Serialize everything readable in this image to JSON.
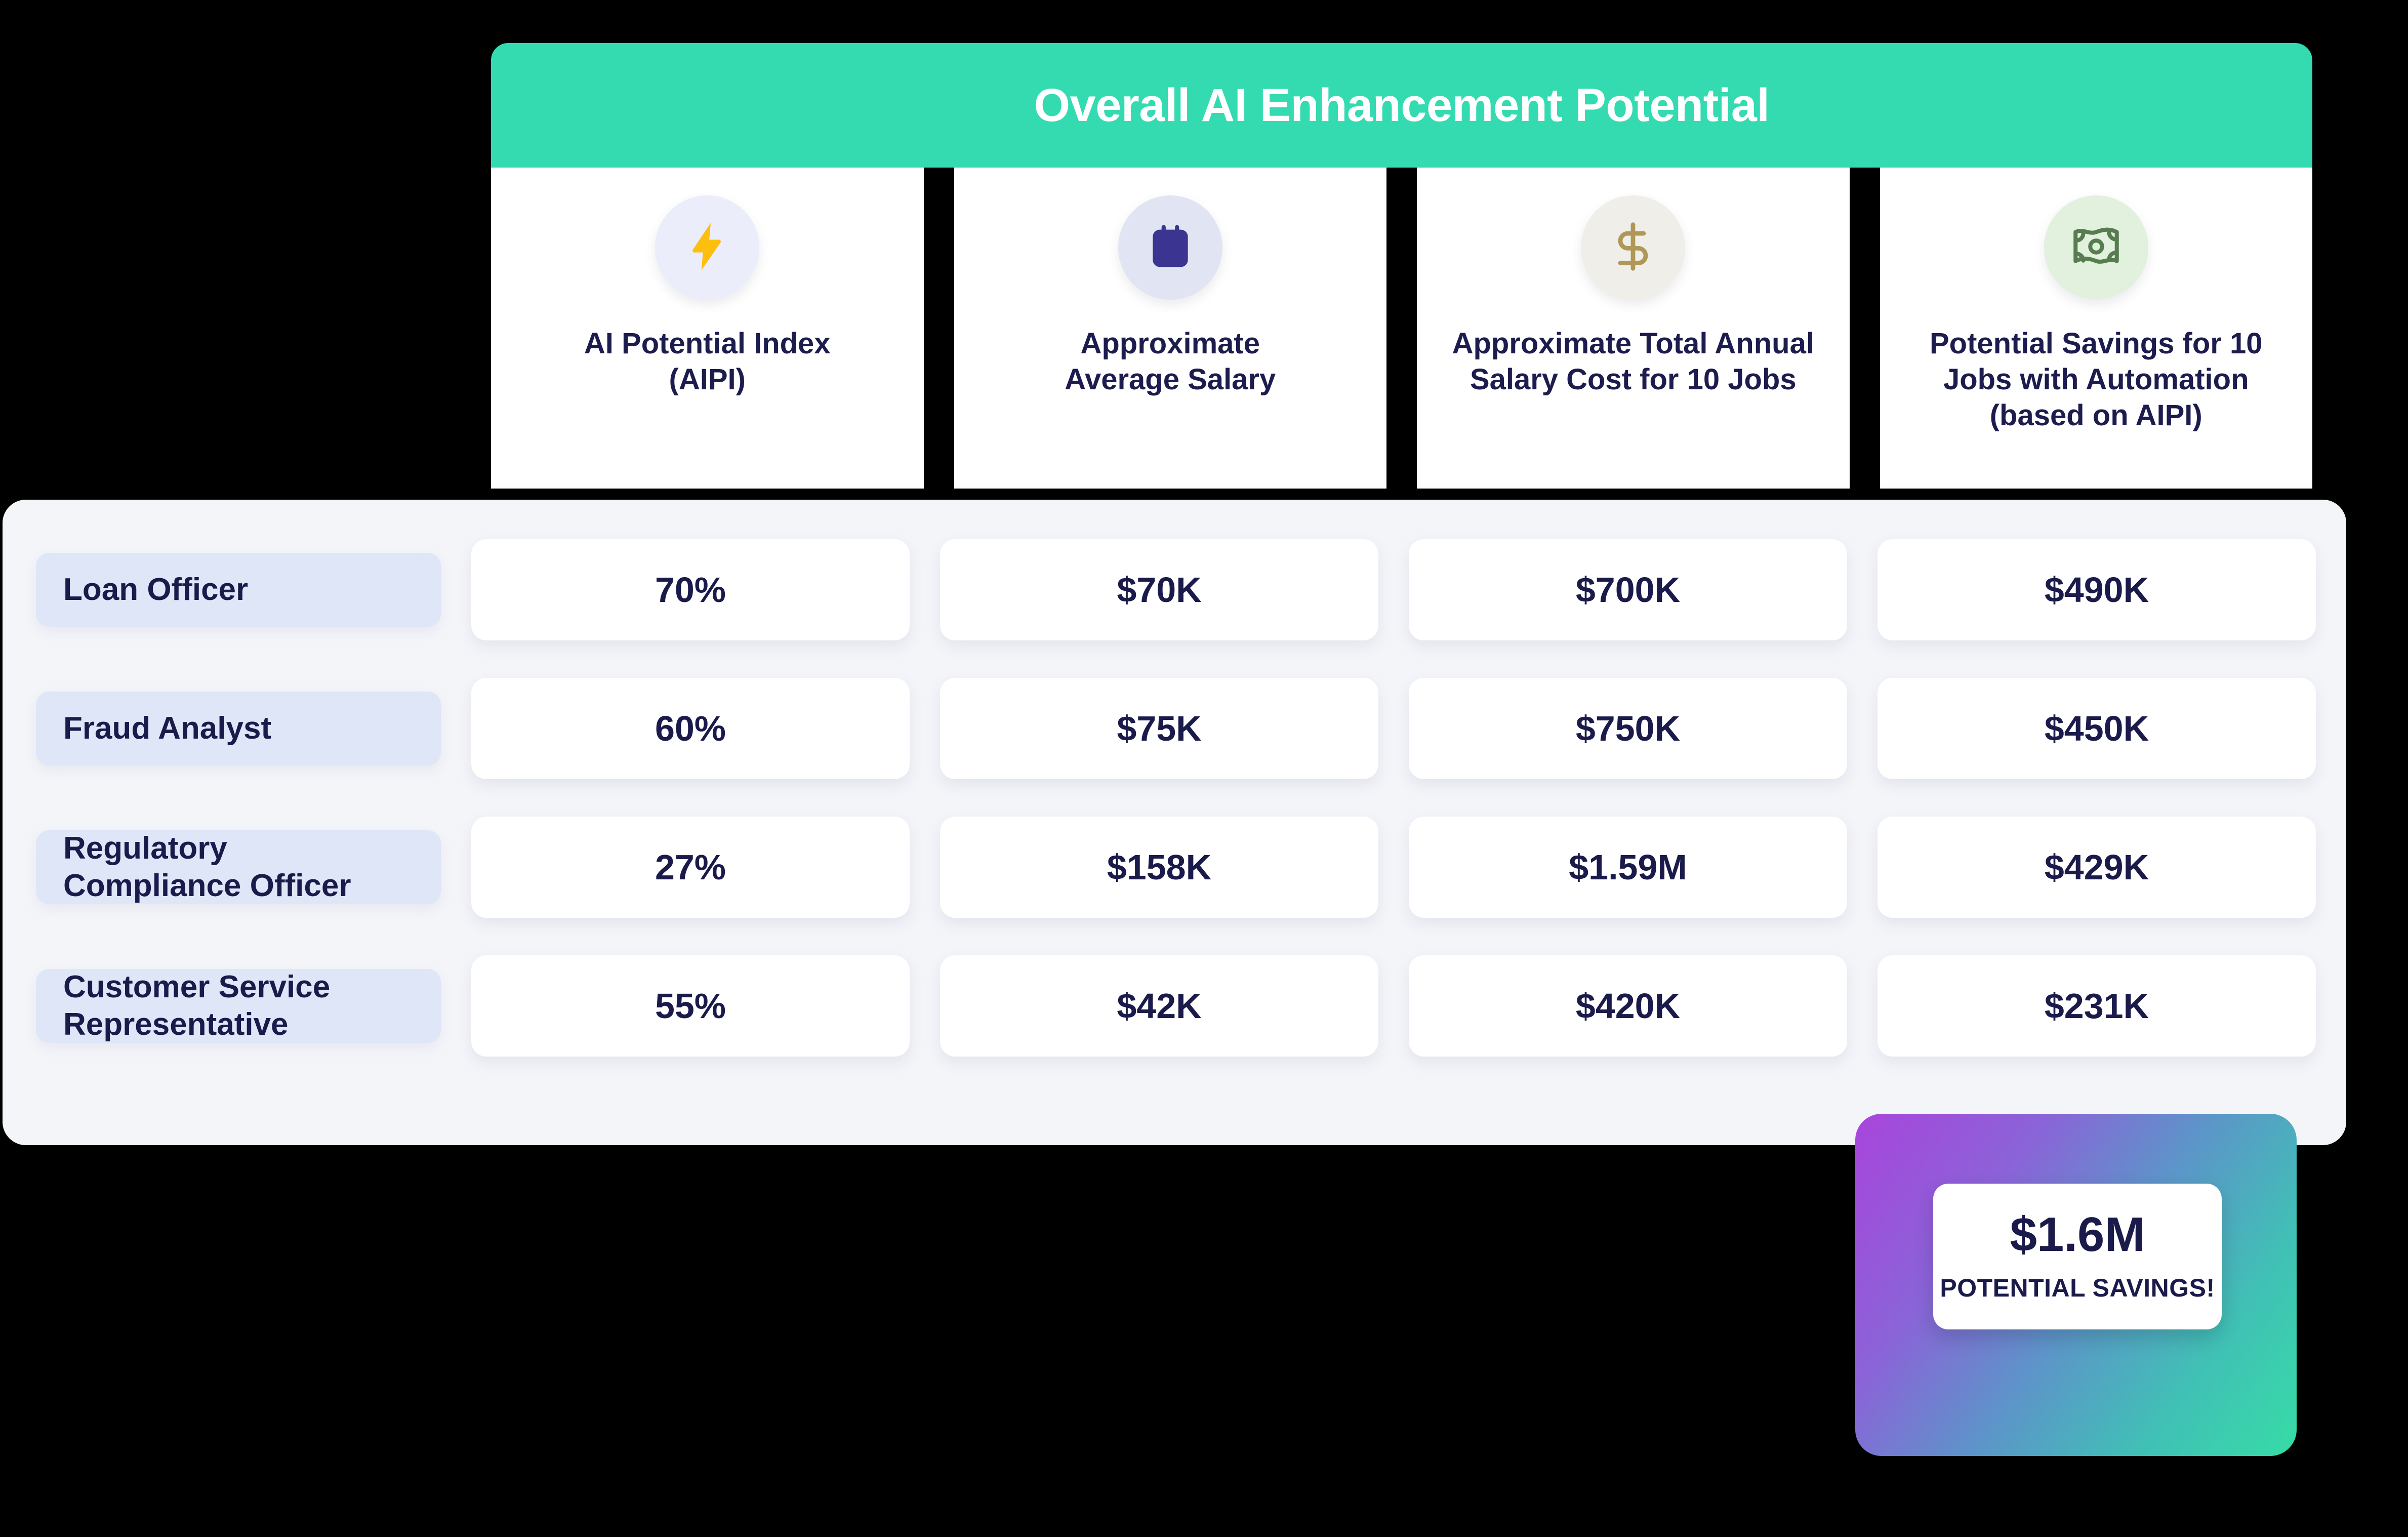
{
  "header": {
    "title": "Overall AI Enhancement Potential",
    "bar_color": "#35DBB0",
    "columns": [
      {
        "label": "AI Potential Index\n(AIPI)",
        "icon": "lightning-bolt-icon",
        "icon_color": "#FCBF10",
        "circle_color": "#EBEDFB"
      },
      {
        "label": "Approximate\nAverage Salary",
        "icon": "calendar-icon",
        "icon_color": "#3B3490",
        "circle_color": "#E1E4F2"
      },
      {
        "label": "Approximate Total Annual\nSalary Cost for 10 Jobs",
        "icon": "dollar-sign-icon",
        "icon_color": "#AF9757",
        "circle_color": "#F0EEE8"
      },
      {
        "label": "Potential Savings for 10\nJobs with Automation\n(based on AIPI)",
        "icon": "banknote-icon",
        "icon_color": "#567C4F",
        "circle_color": "#E2F0DE"
      }
    ]
  },
  "chart_data": {
    "type": "table",
    "title": "Overall AI Enhancement Potential",
    "columns": [
      "AI Potential Index (AIPI)",
      "Approximate Average Salary",
      "Approximate Total Annual Salary Cost for 10 Jobs",
      "Potential Savings for 10 Jobs with Automation (based on AIPI)"
    ],
    "row_labels": [
      "Loan Officer",
      "Fraud Analyst",
      "Regulatory Compliance Officer",
      "Customer Service Representative"
    ],
    "rows": [
      {
        "label": "Loan Officer",
        "aipi": "70%",
        "avg_salary": "$70K",
        "total_cost": "$700K",
        "savings": "$490K"
      },
      {
        "label": "Fraud Analyst",
        "aipi": "60%",
        "avg_salary": "$75K",
        "total_cost": "$750K",
        "savings": "$450K"
      },
      {
        "label": "Regulatory\nCompliance Officer",
        "aipi": "27%",
        "avg_salary": "$158K",
        "total_cost": "$1.59M",
        "savings": "$429K"
      },
      {
        "label": "Customer Service\nRepresentative",
        "aipi": "55%",
        "avg_salary": "$42K",
        "total_cost": "$420K",
        "savings": "$231K"
      }
    ],
    "total_savings": "$1.6M",
    "total_savings_caption": "POTENTIAL SAVINGS!"
  },
  "savings_badge": {
    "amount": "$1.6M",
    "caption": "POTENTIAL SAVINGS!",
    "gradient_from": "#A845DC",
    "gradient_to": "#36DCA6"
  },
  "theme": {
    "text_navy": "#1A1A4B",
    "panel_bg": "#F4F5F9",
    "row_label_bg": "#DFE6F8",
    "cell_bg": "#FFFFFF"
  }
}
